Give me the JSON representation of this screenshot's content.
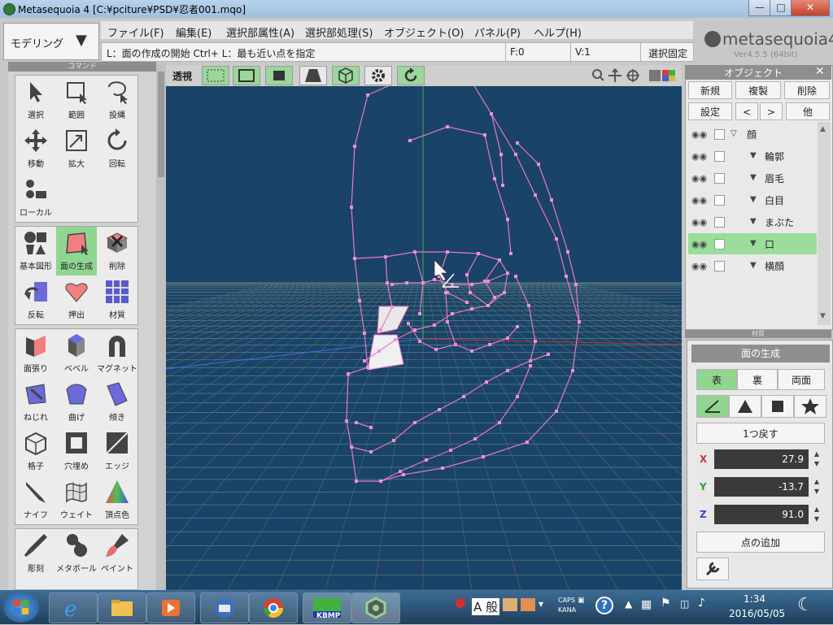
{
  "window": {
    "title": "Metasequoia 4 [C:¥pciture¥PSD¥忍者001.mqo]"
  },
  "mode": {
    "label": "モデリング"
  },
  "menu": [
    "ファイル(F)",
    "編集(E)",
    "選択部属性(A)",
    "選択部処理(S)",
    "オブジェクト(O)",
    "パネル(P)",
    "ヘルプ(H)"
  ],
  "status": {
    "hint": "L：面の作成の開始  Ctrl+ L：最も近い点を指定",
    "faces": "F:0",
    "vertices": "V:1",
    "lock": "選択固定"
  },
  "logo": {
    "name": "metasequoia4",
    "version": "Ver4.5.5 (64bit)"
  },
  "toolbox": {
    "header": "コマンド",
    "groups": [
      {
        "tools": [
          "選択",
          "範囲",
          "投縄",
          "移動",
          "拡大",
          "回転",
          "ローカル"
        ]
      },
      {
        "tools": [
          "基本図形",
          "面の生成",
          "削除",
          "反転",
          "押出",
          "材質"
        ]
      },
      {
        "tools": [
          "面張り",
          "ベベル",
          "マグネット",
          "ねじれ",
          "曲げ",
          "傾き",
          "格子",
          "穴埋め",
          "エッジ",
          "ナイフ",
          "ウェイト",
          "頂点色"
        ]
      },
      {
        "tools": [
          "彫刻",
          "メタボール",
          "ペイント"
        ]
      }
    ],
    "active_tool": "面の生成"
  },
  "viewport": {
    "projection_label": "透視"
  },
  "object_panel": {
    "title": "オブジェクト",
    "buttons": [
      "新規",
      "複製",
      "削除",
      "設定",
      "<",
      ">",
      "他"
    ],
    "objects": [
      {
        "name": "顔",
        "level": 0,
        "selected": false
      },
      {
        "name": "輪郭",
        "level": 1,
        "selected": false
      },
      {
        "name": "眉毛",
        "level": 1,
        "selected": false
      },
      {
        "name": "白目",
        "level": 1,
        "selected": false
      },
      {
        "name": "まぶた",
        "level": 1,
        "selected": false
      },
      {
        "name": "口",
        "level": 1,
        "selected": true
      },
      {
        "name": "横顔",
        "level": 1,
        "selected": false
      }
    ],
    "collapsed_label": "材質"
  },
  "face_panel": {
    "title": "面の生成",
    "sides": [
      "表",
      "裏",
      "両面"
    ],
    "undo_label": "1つ戻す",
    "x_label": "X",
    "x_value": "27.9",
    "y_label": "Y",
    "y_value": "-13.7",
    "z_label": "Z",
    "z_value": "91.0",
    "add_point_label": "点の追加"
  },
  "taskbar": {
    "ime": "A 般",
    "caps": "CAPS",
    "kana": "KANA",
    "time": "1:34",
    "date": "2016/05/05",
    "app_label": "KBMP"
  },
  "colors": {
    "viewport_bg": "#1a4367",
    "mesh": "#e878c8",
    "active": "#90d690"
  }
}
